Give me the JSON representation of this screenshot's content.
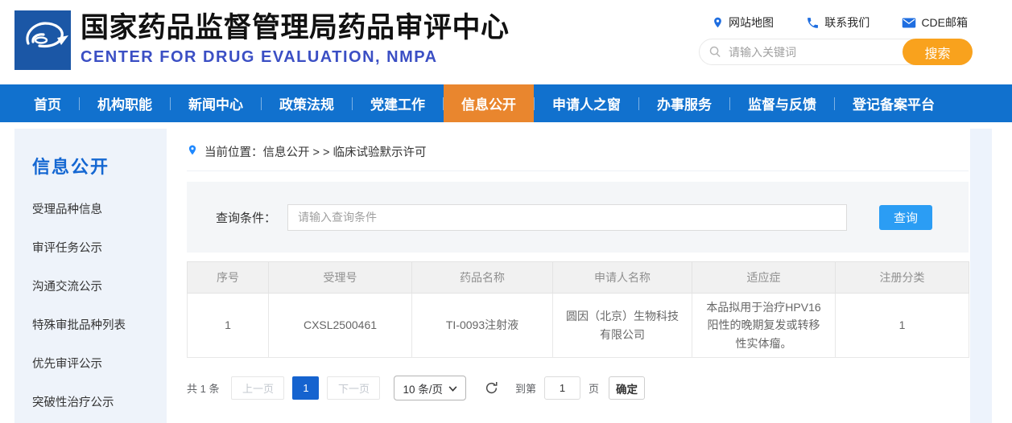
{
  "header": {
    "title": "国家药品监督管理局药品审评中心",
    "subtitle": "CENTER FOR DRUG EVALUATION, NMPA",
    "quick_links": [
      {
        "icon": "location-pin-icon",
        "label": "网站地图"
      },
      {
        "icon": "phone-icon",
        "label": "联系我们"
      },
      {
        "icon": "envelope-icon",
        "label": "CDE邮箱"
      }
    ],
    "search": {
      "placeholder": "请输入关键词",
      "button_label": "搜索"
    }
  },
  "nav": {
    "items": [
      {
        "label": "首页",
        "active": false
      },
      {
        "label": "机构职能",
        "active": false
      },
      {
        "label": "新闻中心",
        "active": false
      },
      {
        "label": "政策法规",
        "active": false
      },
      {
        "label": "党建工作",
        "active": false
      },
      {
        "label": "信息公开",
        "active": true
      },
      {
        "label": "申请人之窗",
        "active": false
      },
      {
        "label": "办事服务",
        "active": false
      },
      {
        "label": "监督与反馈",
        "active": false
      },
      {
        "label": "登记备案平台",
        "active": false
      }
    ]
  },
  "sidebar": {
    "title": "信息公开",
    "items": [
      "受理品种信息",
      "审评任务公示",
      "沟通交流公示",
      "特殊审批品种列表",
      "优先审评公示",
      "突破性治疗公示"
    ]
  },
  "breadcrumb": {
    "text": "当前位置：信息公开 > > 临床试验默示许可"
  },
  "query": {
    "label": "查询条件：",
    "placeholder": "请输入查询条件",
    "button_label": "查询"
  },
  "table": {
    "columns": [
      "序号",
      "受理号",
      "药品名称",
      "申请人名称",
      "适应症",
      "注册分类"
    ],
    "rows": [
      [
        "1",
        "CXSL2500461",
        "TI-0093注射液",
        "圆因（北京）生物科技有限公司",
        "本品拟用于治疗HPV16阳性的晚期复发或转移性实体瘤。",
        "1"
      ]
    ]
  },
  "pagination": {
    "total": "共 1 条",
    "prev_label": "上一页",
    "current_page": "1",
    "next_label": "下一页",
    "page_size": "10 条/页",
    "goto_label": "到第",
    "goto_value": "1",
    "page_unit": "页",
    "confirm_label": "确定"
  },
  "colors": {
    "nav_blue": "#1171ce",
    "nav_active_orange": "#e9862e",
    "search_button_orange": "#f9a21d",
    "query_button_blue": "#2b9df4",
    "pager_active_blue": "#1563cf",
    "sidebar_title_blue": "#1467d2",
    "subtitle_blue": "#3b4fc4",
    "link_icon_blue": "#1f6ee0"
  }
}
